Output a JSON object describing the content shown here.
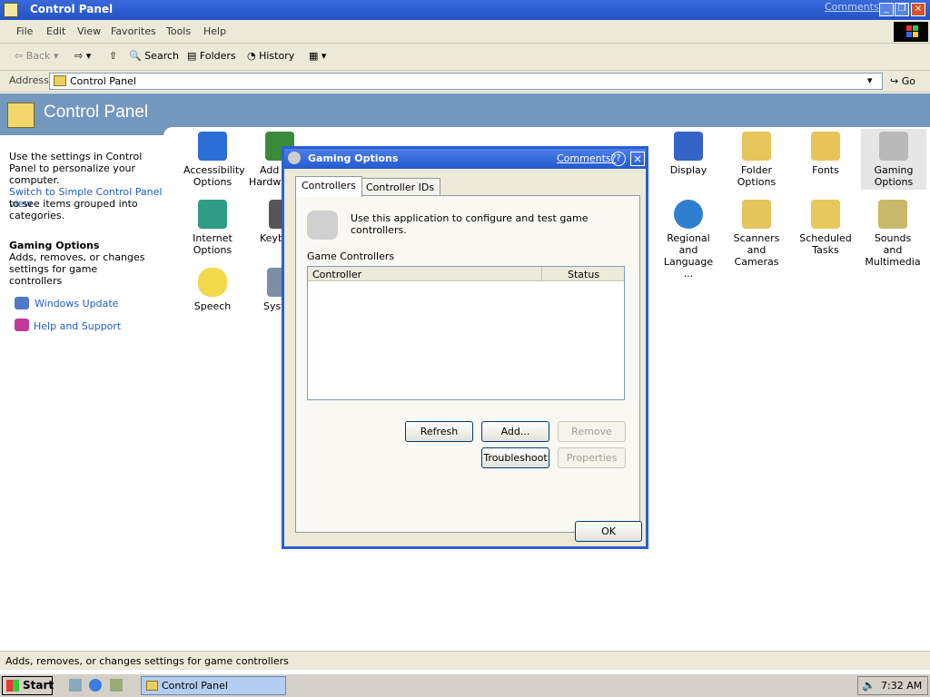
{
  "window": {
    "title": "Control Panel",
    "comments_link": "Comments?"
  },
  "menu": [
    "File",
    "Edit",
    "View",
    "Favorites",
    "Tools",
    "Help"
  ],
  "toolbar": {
    "back": "Back",
    "search": "Search",
    "folders": "Folders",
    "history": "History"
  },
  "address": {
    "label": "Address",
    "value": "Control Panel",
    "go": "Go"
  },
  "header": {
    "title": "Control Panel"
  },
  "left": {
    "intro": "Use the settings in Control Panel to personalize your computer.",
    "switch_link": "Switch to Simple Control Panel view",
    "switch_rest": "to see items grouped into categories.",
    "selected_title": "Gaming Options",
    "selected_desc": "Adds, removes, or changes settings for game controllers",
    "links": [
      "Windows Update",
      "Help and Support"
    ]
  },
  "icons": {
    "accessibility": "Accessibility Options",
    "add_hardware": "Add Hardw",
    "display": "Display",
    "folder_options": "Folder Options",
    "fonts": "Fonts",
    "gaming": "Gaming Options",
    "internet": "Internet Options",
    "keyboard": "Keyb",
    "regional": "Regional and Language ...",
    "scanners": "Scanners and Cameras",
    "scheduled": "Scheduled Tasks",
    "sounds": "Sounds and Multimedia",
    "speech": "Speech",
    "system": "Syst"
  },
  "dialog": {
    "title": "Gaming Options",
    "comments": "Comments?",
    "help": "?",
    "close": "×",
    "tabs": [
      "Controllers",
      "Controller IDs"
    ],
    "description": "Use this application to configure and test game controllers.",
    "group_label": "Game Controllers",
    "columns": [
      "Controller",
      "Status"
    ],
    "rows": [],
    "buttons": {
      "refresh": "Refresh",
      "add": "Add...",
      "remove": "Remove",
      "troubleshoot": "Troubleshoot",
      "properties": "Properties",
      "ok": "OK"
    }
  },
  "statusbar": {
    "text": "Adds, removes, or changes settings for game controllers"
  },
  "taskbar": {
    "start": "Start",
    "task": "Control Panel",
    "clock": "7:32 AM"
  }
}
